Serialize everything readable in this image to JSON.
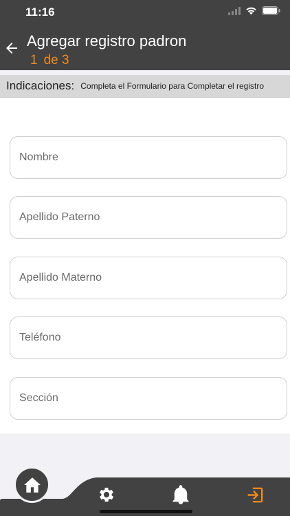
{
  "status_bar": {
    "time": "11:16"
  },
  "header": {
    "title": "Agregar registro padron",
    "step_current": "1",
    "step_label": "de 3",
    "accent_color": "#f08a1c"
  },
  "indications": {
    "label": "Indicaciones:",
    "text": "Completa el Formulario para Completar el registro"
  },
  "form": {
    "fields": [
      {
        "placeholder": "Nombre"
      },
      {
        "placeholder": "Apellido Paterno"
      },
      {
        "placeholder": "Apellido Materno"
      },
      {
        "placeholder": "Teléfono"
      },
      {
        "placeholder": "Sección"
      }
    ]
  },
  "bottom_nav": {
    "items": [
      {
        "icon": "home-icon"
      },
      {
        "icon": "gear-icon"
      },
      {
        "icon": "bell-icon"
      },
      {
        "icon": "exit-icon",
        "color": "#f08a1c"
      }
    ]
  }
}
